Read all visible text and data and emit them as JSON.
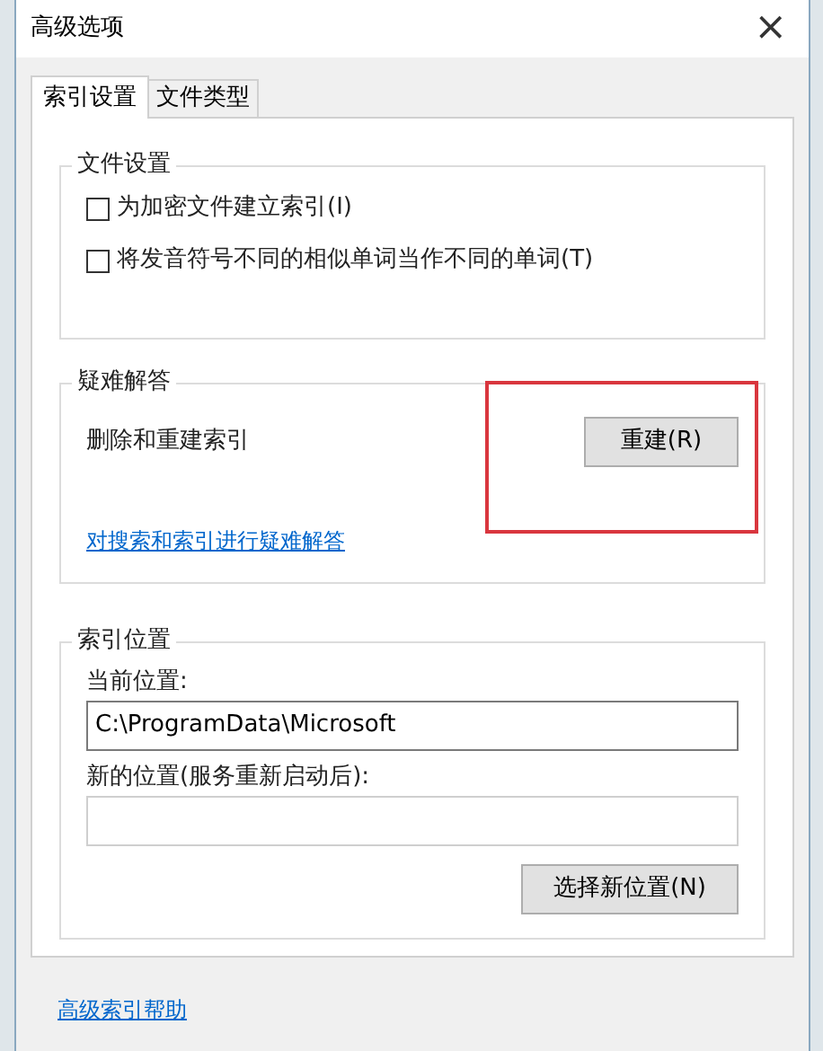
{
  "window": {
    "title": "高级选项",
    "close": "×"
  },
  "tabs": [
    {
      "label": "索引设置",
      "selected": true
    },
    {
      "label": "文件类型",
      "selected": false
    }
  ],
  "file_settings": {
    "title": "文件设置",
    "options": [
      {
        "label": "为加密文件建立索引(I)",
        "checked": false
      },
      {
        "label": "将发音符号不同的相似单词当作不同的单词(T)",
        "checked": false
      }
    ]
  },
  "troubleshooting": {
    "title": "疑难解答",
    "label": "删除和重建索引",
    "button": "重建(R)",
    "highlighted": true,
    "link": "对搜索和索引进行疑难解答"
  },
  "index_location": {
    "title": "索引位置",
    "current_label": "当前位置:",
    "current_value": "C:\\ProgramData\\Microsoft",
    "new_label": "新的位置(服务重新启动后):",
    "button": "选择新位置(N)"
  },
  "help_link": "高级索引帮助"
}
